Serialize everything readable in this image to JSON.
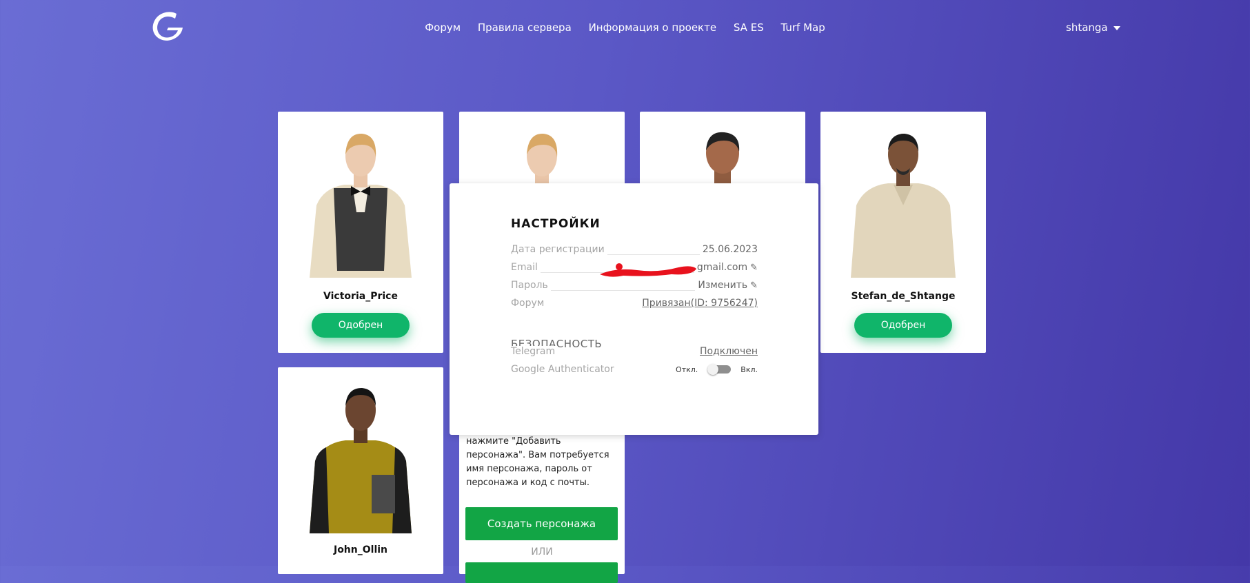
{
  "nav": {
    "items": [
      "Форум",
      "Правила сервера",
      "Информация о проекте",
      "SA ES",
      "Turf Map"
    ]
  },
  "user": {
    "name": "shtanga"
  },
  "cards": [
    {
      "name": "Victoria_Price",
      "status": "Одобрен"
    },
    {
      "name": "",
      "status": ""
    },
    {
      "name": "",
      "status": ""
    },
    {
      "name": "Stefan_de_Shtange",
      "status": "Одобрен"
    },
    {
      "name": "John_Ollin",
      "status": ""
    }
  ],
  "create_card": {
    "help_text": "нажмите \"Добавить персонажа\". Вам потребуется имя персонажа, пароль от персонажа и код с почты.",
    "create_label": "Создать персонажа",
    "or_label": "ИЛИ"
  },
  "settings": {
    "title": "НАСТРОЙКИ",
    "rows": [
      {
        "label": "Дата регистрации",
        "value": "25.06.2023"
      },
      {
        "label": "Email",
        "value": "gmail.com"
      },
      {
        "label": "Пароль",
        "value": "Изменить"
      },
      {
        "label": "Форум",
        "value": "Привязан(ID: 9756247)"
      }
    ],
    "security_title": "БЕЗОПАСНОСТЬ",
    "security_rows": [
      {
        "label": "Telegram",
        "value": "Подключен"
      },
      {
        "label": "Google Authenticator",
        "off_label": "Откл.",
        "on_label": "Вкл."
      }
    ]
  },
  "colors": {
    "accent_green": "#10b56a",
    "button_green": "#12a545",
    "bg_start": "#6a6dd4",
    "bg_end": "#4438a8"
  },
  "icons": {
    "logo": "logo-g",
    "caret": "caret-down-icon",
    "edit": "pencil-icon"
  }
}
